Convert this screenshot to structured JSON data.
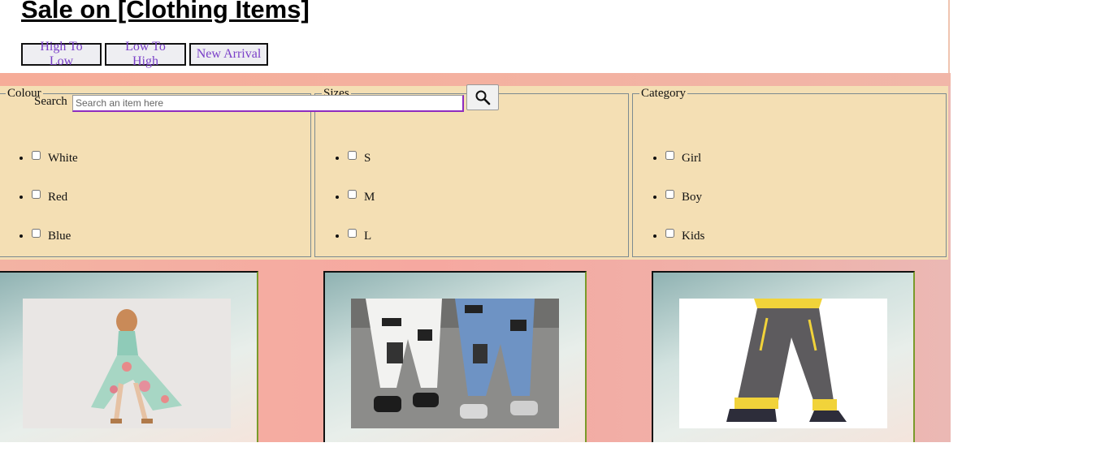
{
  "header": {
    "title": "Sale on [Clothing Items]"
  },
  "sort_buttons": [
    {
      "label": "High To Low"
    },
    {
      "label": "Low To High"
    },
    {
      "label": "New Arrival"
    }
  ],
  "search": {
    "label": "Search",
    "placeholder": "Search an item here",
    "button_icon": "search-icon"
  },
  "filters": {
    "colour": {
      "legend": "Colour",
      "options": [
        "White",
        "Red",
        "Blue"
      ]
    },
    "sizes": {
      "legend": "Sizes",
      "options": [
        "S",
        "M",
        "L"
      ]
    },
    "category": {
      "legend": "Category",
      "options": [
        "Girl",
        "Boy",
        "Kids"
      ]
    }
  },
  "products": [
    {
      "image": "floral-high-low-dress"
    },
    {
      "image": "ripped-jeans-white-and-blue"
    },
    {
      "image": "grey-jogger-pants"
    }
  ],
  "colors": {
    "button_text": "#7a3fc8",
    "filter_panel": "#f4dfb4",
    "band": "#f6a8a0",
    "search_focus": "#8e2bbf"
  }
}
